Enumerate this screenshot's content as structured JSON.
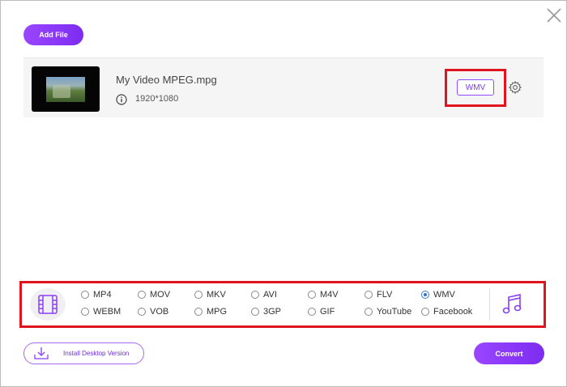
{
  "header": {
    "add_file_label": "Add File",
    "close_icon": "close-icon"
  },
  "file": {
    "name": "My Video MPEG.mpg",
    "resolution": "1920*1080",
    "output_format": "WMV",
    "info_icon": "info-icon",
    "settings_icon": "gear-icon"
  },
  "formats": {
    "selected": "WMV",
    "row1": [
      "MP4",
      "MOV",
      "MKV",
      "AVI",
      "M4V",
      "FLV",
      "WMV"
    ],
    "row2": [
      "WEBM",
      "VOB",
      "MPG",
      "3GP",
      "GIF",
      "YouTube",
      "Facebook"
    ],
    "video_category_icon": "film-icon",
    "audio_category_icon": "music-note-icon"
  },
  "footer": {
    "install_label": "Install Desktop Version",
    "convert_label": "Convert"
  },
  "colors": {
    "accent": "#8b3cf7",
    "highlight_box": "#e0141e",
    "radio_selected": "#2e6fd1"
  }
}
